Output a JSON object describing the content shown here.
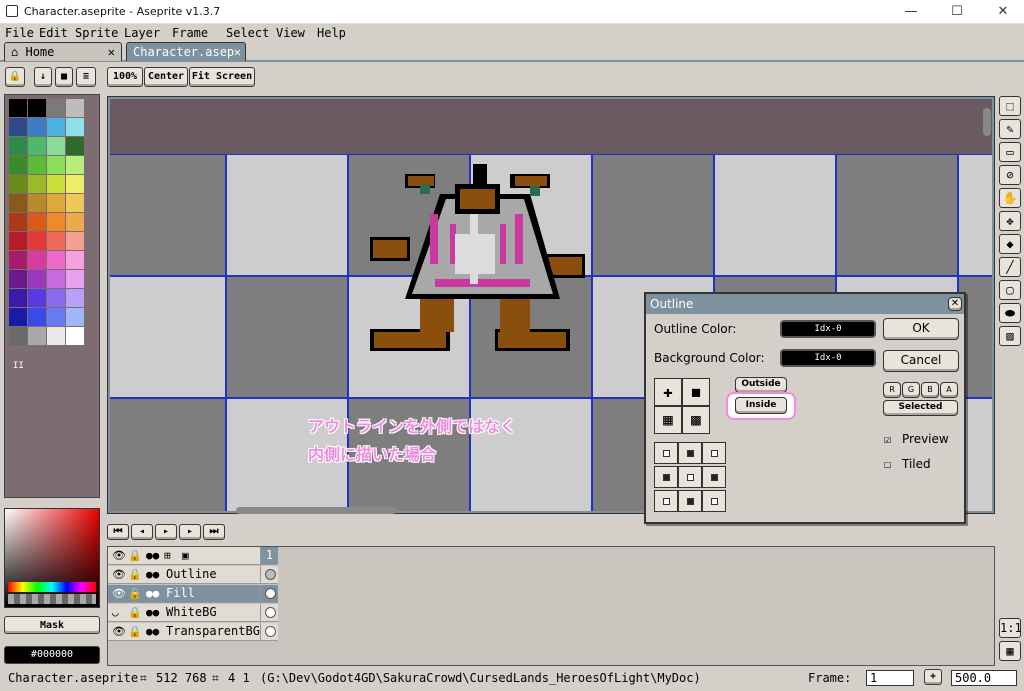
{
  "window": {
    "title": "Character.aseprite - Aseprite v1.3.7",
    "minimize": "—",
    "maximize": "☐",
    "close": "✕"
  },
  "menu": [
    "File",
    "Edit",
    "Sprite",
    "Layer",
    "Frame",
    "Select",
    "View",
    "Help"
  ],
  "tabs": [
    {
      "label": "Home",
      "close": "✕",
      "icon": "home-icon"
    },
    {
      "label": "Character.asep",
      "close": "✕"
    }
  ],
  "toolbar": {
    "zoom_100": "100%",
    "center": "Center",
    "fit_screen": "Fit Screen"
  },
  "palette": {
    "swatches": [
      "#000000",
      "#000000",
      "#7a7a7a",
      "#bdbdbd",
      "#2d4a8a",
      "#3e7cc4",
      "#4ab3e0",
      "#8fe0e8",
      "#2e8a4a",
      "#4cba6a",
      "#8adc9a",
      "#2e6a2a",
      "#3a8a2a",
      "#5cba3a",
      "#8ade5a",
      "#b8ee7a",
      "#6a8a1a",
      "#9aba2a",
      "#cade3a",
      "#eeee6a",
      "#8a5a1a",
      "#ba8a2a",
      "#dea83a",
      "#eec85a",
      "#aa3a1a",
      "#da5a1a",
      "#ee8a2a",
      "#eeaa4a",
      "#b81a2a",
      "#e23a3a",
      "#ee6a5a",
      "#f8a090",
      "#a81a6a",
      "#d83aa0",
      "#ee6ac8",
      "#f8a0e0",
      "#6a1a8a",
      "#9a3ab8",
      "#c86ae0",
      "#e8a0f0",
      "#3a1aa8",
      "#5a3ae0",
      "#8a6af0",
      "#b8a0f8",
      "#1a1aa8",
      "#3a4ae8",
      "#6a7af0",
      "#a0b8f8",
      "#6a6a6a",
      "#a8a8a8",
      "#e8e8e8",
      "#ffffff"
    ],
    "count_label": "II"
  },
  "color_panel": {
    "mask_label": "Mask",
    "current_color": "#000000"
  },
  "annotation": {
    "line1": "アウトラインを外側ではなく",
    "line2": "内側に描いた場合"
  },
  "dialog": {
    "title": "Outline",
    "outline_color_label": "Outline Color:",
    "outline_color_value": "Idx-0",
    "background_color_label": "Background Color:",
    "background_color_value": "Idx-0",
    "ok": "OK",
    "cancel": "Cancel",
    "outside": "Outside",
    "inside": "Inside",
    "channels": [
      "R",
      "G",
      "B",
      "A"
    ],
    "selected": "Selected",
    "preview_label": "Preview",
    "tiled_label": "Tiled",
    "preview_checked": true,
    "tiled_checked": false
  },
  "timeline": {
    "frame_number": "1",
    "layers": [
      {
        "name": "Outline",
        "selected": false
      },
      {
        "name": "Fill",
        "selected": true
      },
      {
        "name": "WhiteBG",
        "selected": false
      },
      {
        "name": "TransparentBG",
        "selected": false
      }
    ]
  },
  "status": {
    "filename": "Character.aseprite",
    "size": "512 768",
    "grid": "4 1",
    "path": "(G:\\Dev\\Godot4GD\\SakuraCrowd\\CursedLands_HeroesOfLight\\MyDoc)",
    "frame_label": "Frame:",
    "frame_value": "1",
    "add": "+",
    "zoom": "500.0"
  },
  "right_panel": {
    "onion": "1:1"
  },
  "colors": {
    "accent": "#7d929e",
    "grid_line": "#2230c8",
    "annotation": "#f28be0"
  }
}
